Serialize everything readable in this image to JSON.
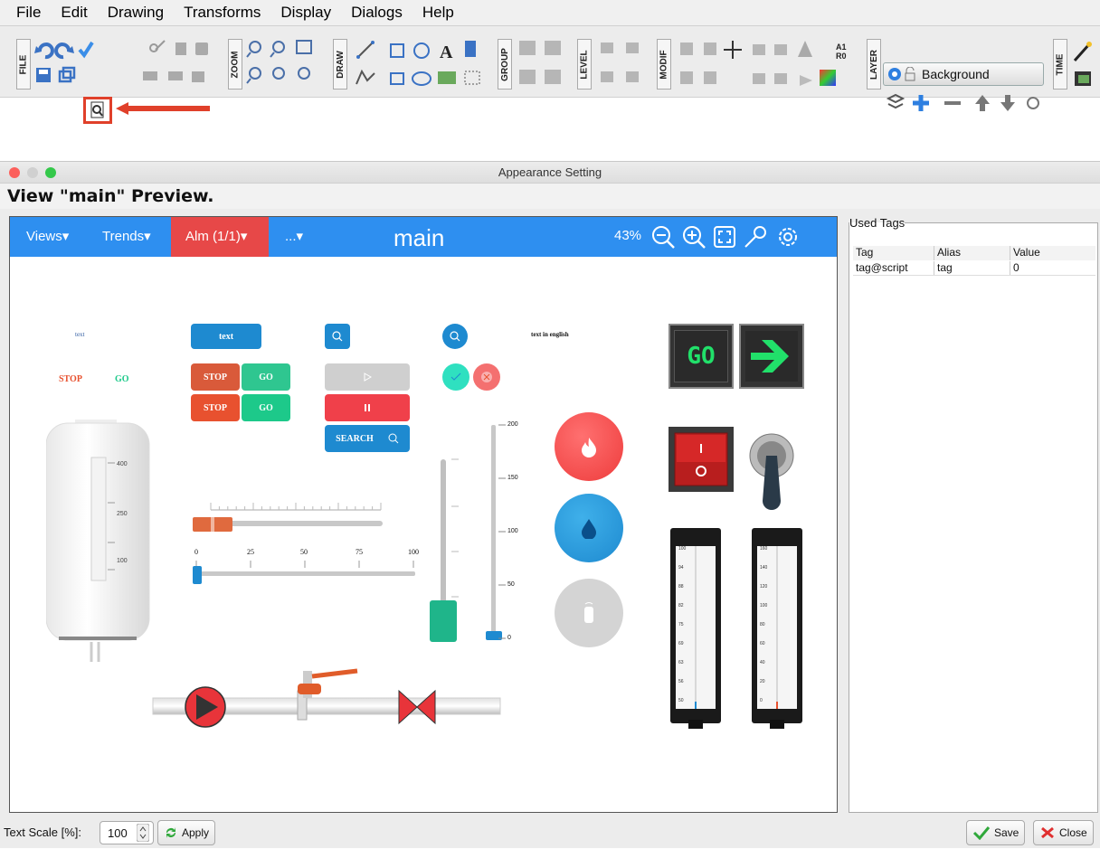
{
  "menu": [
    "File",
    "Edit",
    "Drawing",
    "Transforms",
    "Display",
    "Dialogs",
    "Help"
  ],
  "toolbar": {
    "groups": [
      "FILE",
      "ZOOM",
      "DRAW",
      "GROUP",
      "LEVEL",
      "MODIF",
      "LAYER",
      "TIME"
    ],
    "layer_name": "Background",
    "font_icon": "A1\nR0",
    "icons": [
      "undo-icon",
      "redo-icon",
      "check-icon",
      "save-icon",
      "windows-icon",
      "preview-icon",
      "cut-icon",
      "copy-icon",
      "paste-icon",
      "zoom-in-icon",
      "zoom-out-icon",
      "line-icon",
      "rect-icon",
      "ellipse-icon",
      "text-icon",
      "image-icon",
      "group-icon",
      "ungroup-icon",
      "bring-front-icon",
      "send-back-icon",
      "align-icon",
      "move-icon",
      "eye-icon",
      "lock-icon",
      "plus-icon",
      "minus-icon",
      "up-icon",
      "down-icon",
      "gear-icon",
      "magic-wand-icon",
      "film-icon"
    ]
  },
  "dialog": {
    "title": "Appearance Setting",
    "heading": "View \"main\" Preview.",
    "preview": {
      "nav": {
        "views": "Views▾",
        "trends": "Trends▾",
        "alarms": "Alm (1/1)▾",
        "more": "...▾",
        "title": "main",
        "zoom": "43%"
      },
      "texts": {
        "text1": "text",
        "text_btn": "text",
        "text_english": "text in english",
        "stop": "STOP",
        "go": "GO",
        "search": "SEARCH",
        "go_big": "GO"
      },
      "tank_scale": [
        "400",
        "250",
        "100"
      ],
      "slider_ticks": [
        "0",
        "25",
        "50",
        "75",
        "100"
      ],
      "vslider_ticks": [
        "200",
        "150",
        "100",
        "50",
        "0"
      ],
      "slider_value": 0,
      "thermo1": [
        "100",
        "94",
        "88",
        "82",
        "75",
        "69",
        "63",
        "56",
        "50"
      ],
      "thermo2": [
        "160",
        "140",
        "120",
        "100",
        "80",
        "60",
        "40",
        "20",
        "0"
      ],
      "colors": {
        "navbar": "#2e8ff0",
        "alarm": "#e74848",
        "go_green": "#1dc98a",
        "stop_red": "#e8512f"
      }
    },
    "used_tags": {
      "legend": "Used Tags",
      "columns": [
        "Tag",
        "Alias",
        "Value"
      ],
      "rows": [
        [
          "tag@script",
          "tag",
          "0"
        ]
      ]
    },
    "bottom": {
      "text_scale_label": "Text Scale [%]:",
      "text_scale_value": "100",
      "apply": "Apply",
      "save": "Save",
      "close": "Close"
    }
  }
}
